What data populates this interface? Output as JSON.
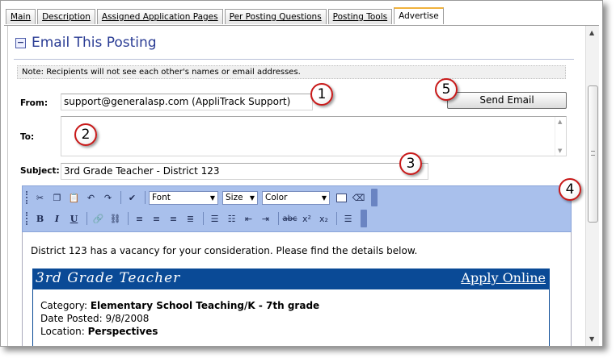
{
  "tabs": [
    {
      "label": "Main"
    },
    {
      "label": "Description"
    },
    {
      "label": "Assigned Application Pages"
    },
    {
      "label": "Per Posting Questions"
    },
    {
      "label": "Posting Tools"
    },
    {
      "label": "Advertise"
    }
  ],
  "section": {
    "title": "Email This Posting",
    "collapse_symbol": "−"
  },
  "note": "Note: Recipients will not see each other's names or email addresses.",
  "form": {
    "from_label": "From:",
    "from_value": "support@generalasp.com (AppliTrack Support)",
    "to_label": "To:",
    "to_value": "",
    "subject_label": "Subject:",
    "subject_value": "3rd Grade Teacher - District 123",
    "send_label": "Send Email"
  },
  "callouts": [
    "1",
    "2",
    "3",
    "4",
    "5"
  ],
  "toolbar": {
    "font_label": "Font",
    "size_label": "Size",
    "color_label": "Color",
    "bold": "B",
    "italic": "I",
    "underline": "U",
    "strike": "abc",
    "superscript": "x²",
    "subscript": "x₂"
  },
  "editor": {
    "intro": "District 123 has a vacancy for your consideration. Please find the details below.",
    "job_title": "3rd Grade Teacher",
    "apply_link": "Apply Online",
    "category_label": "Category:",
    "category_value": "Elementary School Teaching/K - 7th grade",
    "date_label": "Date Posted:",
    "date_value": "9/8/2008",
    "location_label": "Location:",
    "location_value": "Perspectives"
  },
  "colors": {
    "accent": "#2a3c94",
    "banner": "#0a4a96",
    "callout_border": "#c81818",
    "toolbar": "#a9c0ec",
    "active_tab": "#f0b23c"
  }
}
